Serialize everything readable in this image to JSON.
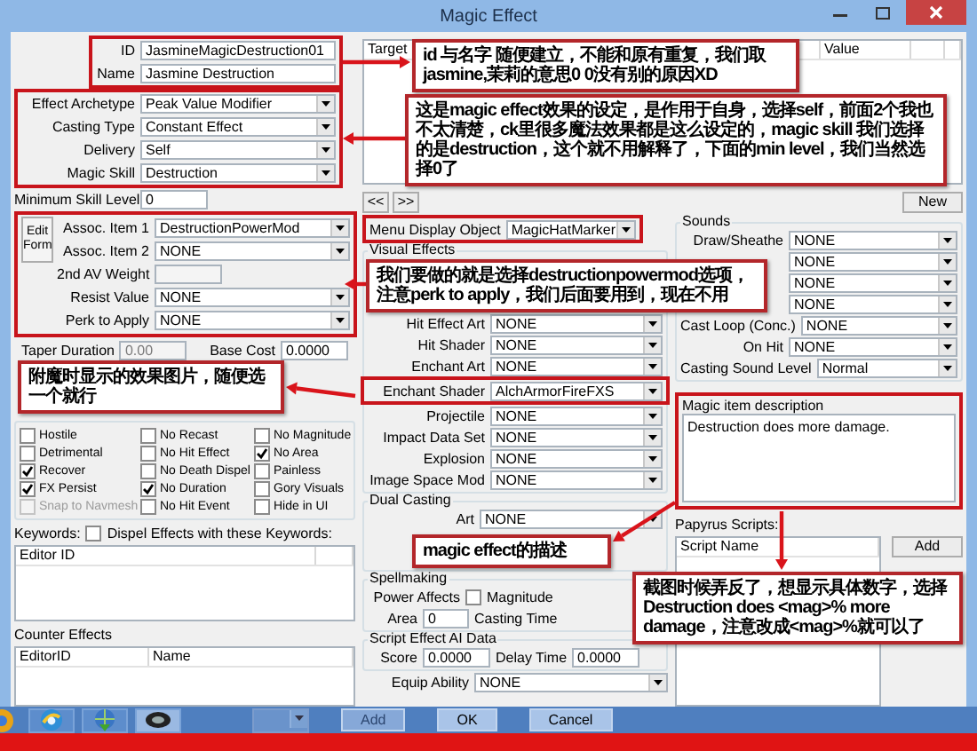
{
  "window": {
    "title": "Magic Effect"
  },
  "identity": [
    {
      "label": "ID",
      "value": "JasmineMagicDestruction01"
    },
    {
      "label": "Name",
      "value": "Jasmine Destruction"
    }
  ],
  "effect_settings": [
    {
      "label": "Effect Archetype",
      "value": "Peak Value Modifier"
    },
    {
      "label": "Casting Type",
      "value": "Constant Effect"
    },
    {
      "label": "Delivery",
      "value": "Self"
    },
    {
      "label": "Magic Skill",
      "value": "Destruction"
    }
  ],
  "minimum_skill_level": {
    "label": "Minimum Skill Level",
    "value": "0"
  },
  "associated": {
    "edit_button": "Edit Form",
    "items": [
      {
        "kind": "dropdown",
        "label": "Assoc. Item 1",
        "value": "DestructionPowerMod"
      },
      {
        "kind": "dropdown",
        "label": "Assoc. Item 2",
        "value": "NONE"
      },
      {
        "kind": "blank-field",
        "label": "2nd AV Weight"
      },
      {
        "kind": "dropdown",
        "label": "Resist Value",
        "value": "NONE"
      },
      {
        "kind": "dropdown",
        "label": "Perk to Apply",
        "value": "NONE"
      }
    ]
  },
  "costs": [
    {
      "label": "Taper Duration",
      "value": "0.00",
      "disabled": true
    },
    {
      "label": "Base Cost",
      "value": "0.0000",
      "disabled": false
    }
  ],
  "flags": [
    {
      "label": "Hostile",
      "checked": false,
      "disabled": false
    },
    {
      "label": "No Recast",
      "checked": false,
      "disabled": false
    },
    {
      "label": "No Magnitude",
      "checked": false,
      "disabled": false
    },
    {
      "label": "Detrimental",
      "checked": false,
      "disabled": false
    },
    {
      "label": "No Hit Effect",
      "checked": false,
      "disabled": false
    },
    {
      "label": "No Area",
      "checked": true,
      "disabled": false
    },
    {
      "label": "Recover",
      "checked": true,
      "disabled": false
    },
    {
      "label": "No Death Dispel",
      "checked": false,
      "disabled": false
    },
    {
      "label": "Painless",
      "checked": false,
      "disabled": false
    },
    {
      "label": "FX Persist",
      "checked": true,
      "disabled": false
    },
    {
      "label": "No Duration",
      "checked": true,
      "disabled": false
    },
    {
      "label": "Gory Visuals",
      "checked": false,
      "disabled": false
    },
    {
      "label": "Snap to Navmesh",
      "checked": false,
      "disabled": true
    },
    {
      "label": "No Hit Event",
      "checked": false,
      "disabled": false
    },
    {
      "label": "Hide in UI",
      "checked": false,
      "disabled": false
    }
  ],
  "keywords": {
    "label": "Keywords:",
    "dispel_label": "Dispel Effects with these Keywords:",
    "dispel_checked": false,
    "columns": [
      "Editor ID"
    ]
  },
  "counter_effects": {
    "label": "Counter Effects",
    "columns": [
      "EditorID",
      "Name"
    ]
  },
  "effects_table": {
    "columns": [
      "Target",
      "Value"
    ]
  },
  "effect_nav": [
    "<<",
    ">>"
  ],
  "new_button": "New",
  "menu_display_object": {
    "label": "Menu Display Object",
    "value": "MagicHatMarker"
  },
  "visual_effects": {
    "title": "Visual Effects",
    "items": [
      {
        "label": "Hit Effect Art",
        "value": "NONE"
      },
      {
        "label": "Hit Shader",
        "value": "NONE"
      },
      {
        "label": "Enchant Art",
        "value": "NONE"
      },
      {
        "label": "Enchant Shader",
        "value": "AlchArmorFireFXS"
      },
      {
        "label": "Projectile",
        "value": "NONE"
      },
      {
        "label": "Impact Data Set",
        "value": "NONE"
      },
      {
        "label": "Explosion",
        "value": "NONE"
      },
      {
        "label": "Image Space Mod",
        "value": "NONE"
      }
    ]
  },
  "dual_casting": {
    "title": "Dual Casting",
    "items": [
      {
        "label": "Art",
        "value": "NONE"
      }
    ]
  },
  "spellmaking": {
    "title": "Spellmaking",
    "power_affects_label": "Power Affects",
    "magnitude_label": "Magnitude",
    "magnitude_checked": false,
    "area_label": "Area",
    "area_value": "0",
    "casting_time_label": "Casting Time"
  },
  "script_ai": {
    "title": "Script Effect AI Data",
    "items": [
      {
        "label": "Score",
        "value": "0.0000"
      },
      {
        "label": "Delay Time",
        "value": "0.0000"
      }
    ]
  },
  "equip_ability": {
    "label": "Equip Ability",
    "value": "NONE"
  },
  "sounds": {
    "title": "Sounds",
    "items": [
      {
        "label": "Draw/Sheathe",
        "value": "NONE"
      },
      {
        "value": "NONE"
      },
      {
        "value": "NONE"
      },
      {
        "value": "NONE"
      },
      {
        "label": "Cast Loop (Conc.)",
        "value": "NONE"
      },
      {
        "label": "On Hit",
        "value": "NONE"
      },
      {
        "label": "Casting Sound Level",
        "value": "Normal"
      }
    ]
  },
  "description": {
    "label": "Magic item description",
    "text": "Destruction does more damage."
  },
  "papyrus": {
    "label": "Papyrus Scripts:",
    "columns": [
      "Script Name"
    ],
    "add_button": "Add"
  },
  "bottom_buttons": [
    {
      "label": "Add",
      "disabled": true
    },
    {
      "label": "OK",
      "disabled": false
    },
    {
      "label": "Cancel",
      "disabled": false
    }
  ],
  "callouts": [
    "id 与名字 随便建立，不能和原有重复，我们取jasmine,茉莉的意思0 0没有别的原因XD",
    "这是magic effect效果的设定，是作用于自身，选择self，前面2个我也不太清楚，ck里很多魔法效果都是这么设定的，magic skill 我们选择的是destruction，这个就不用解释了，下面的min level，我们当然选择0了",
    "我们要做的就是选择destructionpowermod选项，注意perk to apply，我们后面要用到，现在不用",
    "附魔时显示的效果图片，随便选一个就行",
    "magic effect的描述",
    "截图时候弄反了，想显示具体数字，选择Destruction does <mag>% more damage，注意改成<mag>%就可以了"
  ]
}
